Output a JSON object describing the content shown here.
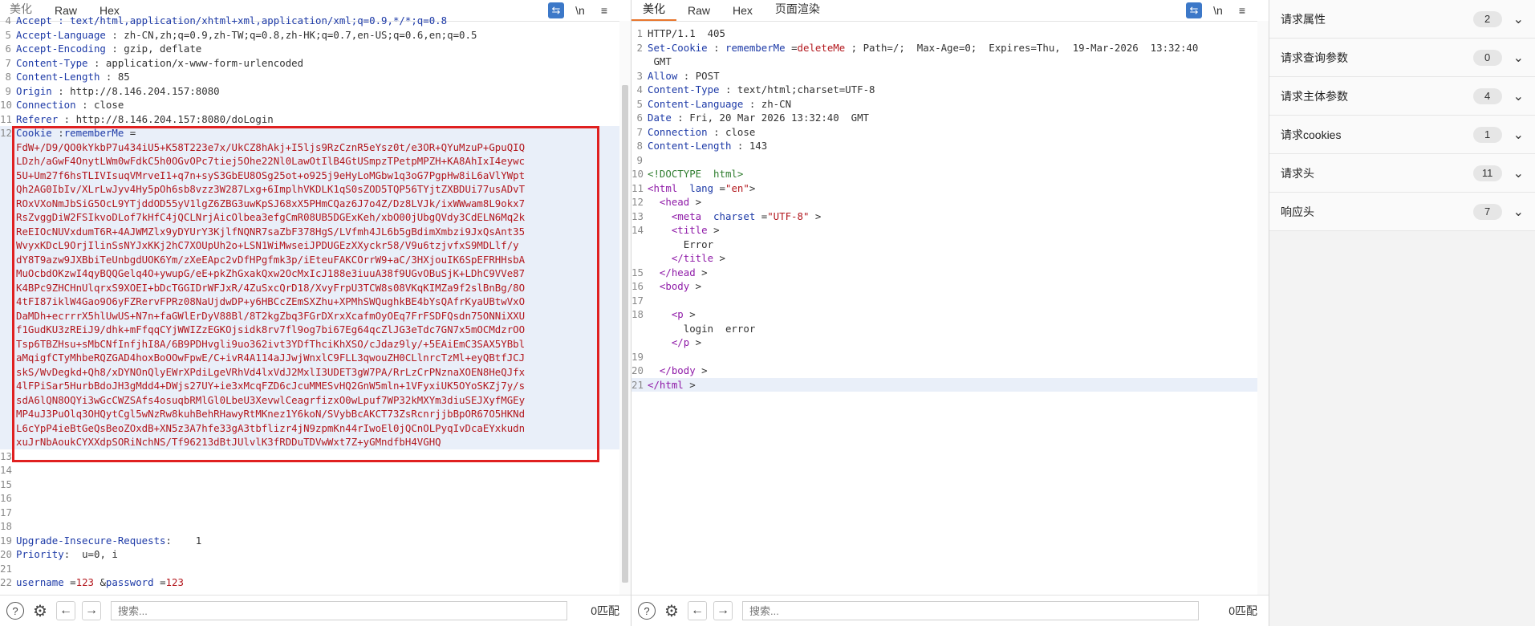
{
  "request": {
    "tabs": [
      "美化",
      "Raw",
      "Hex"
    ],
    "lines": [
      {
        "num": "4",
        "parts": [
          {
            "t": "Accept : text/html,application/xhtml+xml,application/xml;q=0.9,*/*;q=0.8",
            "c": "k"
          }
        ]
      },
      {
        "num": "5",
        "parts": [
          {
            "t": "Accept-Language",
            "c": "k"
          },
          {
            "t": " : zh-CN,zh;q=0.9,zh-TW;q=0.8,zh-HK;q=0.7,en-US;q=0.6,en;q=0.5",
            "c": "v"
          }
        ]
      },
      {
        "num": "6",
        "parts": [
          {
            "t": "Accept-Encoding",
            "c": "k"
          },
          {
            "t": " : gzip, deflate",
            "c": "v"
          }
        ]
      },
      {
        "num": "7",
        "parts": [
          {
            "t": "Content-Type",
            "c": "k"
          },
          {
            "t": " : application/x-www-form-urlencoded",
            "c": "v"
          }
        ]
      },
      {
        "num": "8",
        "parts": [
          {
            "t": "Content-Length",
            "c": "k"
          },
          {
            "t": " : 85",
            "c": "v"
          }
        ]
      },
      {
        "num": "9",
        "parts": [
          {
            "t": "Origin",
            "c": "k"
          },
          {
            "t": " : http://8.146.204.157:8080",
            "c": "v"
          }
        ]
      },
      {
        "num": "10",
        "parts": [
          {
            "t": "Connection",
            "c": "k"
          },
          {
            "t": " : close",
            "c": "v"
          }
        ]
      },
      {
        "num": "11",
        "parts": [
          {
            "t": "Referer",
            "c": "k"
          },
          {
            "t": " : http://8.146.204.157:8080/doLogin",
            "c": "v"
          }
        ]
      },
      {
        "num": "12",
        "hl": true,
        "parts": [
          {
            "t": "Cookie",
            "c": "k"
          },
          {
            "t": " :",
            "c": "v"
          },
          {
            "t": "rememberMe",
            "c": "k"
          },
          {
            "t": " =",
            "c": "v"
          }
        ]
      },
      {
        "num": "",
        "hl": true,
        "parts": [
          {
            "t": "FdW+/D9/QO0kYkbP7u434iU5+K58T223e7x/UkCZ8hAkj+I5ljs9RzCznR5eYsz0t/e3OR+QYuMzuP+GpuQIQ",
            "c": "red"
          }
        ]
      },
      {
        "num": "",
        "hl": true,
        "parts": [
          {
            "t": "LDzh/aGwF4OnytLWm0wFdkC5h0OGvOPc7tiej5Ohe22Nl0LawOtIlB4GtUSmpzTPetpMPZH+KA8AhIxI4eywc",
            "c": "red"
          }
        ]
      },
      {
        "num": "",
        "hl": true,
        "parts": [
          {
            "t": "5U+Um27f6hsTLIVIsuqVMrveI1+q7n+syS3GbEU8OSg25ot+o925j9eHyLoMGbw1q3oG7PgpHw8iL6aVlYWpt",
            "c": "red"
          }
        ]
      },
      {
        "num": "",
        "hl": true,
        "parts": [
          {
            "t": "Qh2AG0IbIv/XLrLwJyv4Hy5pOh6sb8vzz3W287Lxg+6ImplhVKDLK1qS0sZOD5TQP56TYjtZXBDUi77usADvT",
            "c": "red"
          }
        ]
      },
      {
        "num": "",
        "hl": true,
        "parts": [
          {
            "t": "ROxVXoNmJbSiG5OcL9YTjddOD55yV1lgZ6ZBG3uwKpSJ68xX5PHmCQaz6J7o4Z/Dz8LVJk/ixWWwam8L9okx7",
            "c": "red"
          }
        ]
      },
      {
        "num": "",
        "hl": true,
        "parts": [
          {
            "t": "RsZvggDiW2FSIkvoDLof7kHfC4jQCLNrjAicOlbea3efgCmR08UB5DGExKeh/xbO00jUbgQVdy3CdELN6Mq2k",
            "c": "red"
          }
        ]
      },
      {
        "num": "",
        "hl": true,
        "parts": [
          {
            "t": "ReEIOcNUVxdumT6R+4AJWMZlx9yDYUrY3KjlfNQNR7saZbF378HgS/LVfmh4JL6b5gBdimXmbzi9JxQsAnt35",
            "c": "red"
          }
        ]
      },
      {
        "num": "",
        "hl": true,
        "parts": [
          {
            "t": "WvyxKDcL9OrjIlinSsNYJxKKj2hC7XOUpUh2o+LSN1WiMwseiJPDUGEzXXyckr58/V9u6tzjvfxS9MDLlf/y",
            "c": "red"
          }
        ]
      },
      {
        "num": "",
        "hl": true,
        "parts": [
          {
            "t": "dY8T9azw9JXBbiTeUnbgdUOK6Ym/zXeEApc2vDfHPgfmk3p/iEteuFAKCOrrW9+aC/3HXjouIK6SpEFRHHsbA",
            "c": "red"
          }
        ]
      },
      {
        "num": "",
        "hl": true,
        "parts": [
          {
            "t": "MuOcbdOKzwI4qyBQQGelq4O+ywupG/eE+pkZhGxakQxw2OcMxIcJ188e3iuuA38f9UGvOBuSjK+LDhC9VVe87",
            "c": "red"
          }
        ]
      },
      {
        "num": "",
        "hl": true,
        "parts": [
          {
            "t": "K4BPc9ZHCHnUlqrxS9XOEI+bDcTGGIDrWFJxR/4ZuSxcQrD18/XvyFrpU3TCW8s08VKqKIMZa9f2slBnBg/8O",
            "c": "red"
          }
        ]
      },
      {
        "num": "",
        "hl": true,
        "parts": [
          {
            "t": "4tFI87iklW4Gao9O6yFZRervFPRz08NaUjdwDP+y6HBCcZEmSXZhu+XPMhSWQughkBE4bYsQAfrKyaUBtwVxO",
            "c": "red"
          }
        ]
      },
      {
        "num": "",
        "hl": true,
        "parts": [
          {
            "t": "DaMDh+ecrrrX5hlUwUS+N7n+faGWlErDyV88Bl/8T2kgZbq3FGrDXrxXcafmOyOEq7FrFSDFQsdn75ONNiXXU",
            "c": "red"
          }
        ]
      },
      {
        "num": "",
        "hl": true,
        "parts": [
          {
            "t": "f1GudKU3zREiJ9/dhk+mFfqqCYjWWIZzEGKOjsidk8rv7fl9og7bi67Eg64qcZlJG3eTdc7GN7x5mOCMdzrOO",
            "c": "red"
          }
        ]
      },
      {
        "num": "",
        "hl": true,
        "parts": [
          {
            "t": "Tsp6TBZHsu+sMbCNfInfjhI8A/6B9PDHvgli9uo362ivt3YDfThciKhXSO/cJdaz9ly/+5EAiEmC3SAX5YBbl",
            "c": "red"
          }
        ]
      },
      {
        "num": "",
        "hl": true,
        "parts": [
          {
            "t": "aMqigfCTyMhbeRQZGAD4hoxBoOOwFpwE/C+ivR4A114aJJwjWnxlC9FLL3qwouZH0CLlnrcTzMl+eyQBtfJCJ",
            "c": "red"
          }
        ]
      },
      {
        "num": "",
        "hl": true,
        "parts": [
          {
            "t": "skS/WvDegkd+Qh8/xDYNOnQlyEWrXPdiLgeVRhVd4lxVdJ2MxlI3UDET3gW7PA/RrLzCrPNznaXOEN8HeQJfx",
            "c": "red"
          }
        ]
      },
      {
        "num": "",
        "hl": true,
        "parts": [
          {
            "t": "4lFPiSar5HurbBdoJH3gMdd4+DWjs27UY+ie3xMcqFZD6cJcuMMESvHQ2GnW5mln+1VFyxiUK5OYoSKZj7y/s",
            "c": "red"
          }
        ]
      },
      {
        "num": "",
        "hl": true,
        "parts": [
          {
            "t": "sdA6lQN8OQYi3wGcCWZSAfs4osuqbRMlGl0LbeU3XevwlCeagrfizxO0wLpuf7WP32kMXYm3diuSEJXyfMGEy",
            "c": "red"
          }
        ]
      },
      {
        "num": "",
        "hl": true,
        "parts": [
          {
            "t": "MP4uJ3PuOlq3OHQytCgl5wNzRw8kuhBehRHawyRtMKnez1Y6koN/SVybBcAKCT73ZsRcnrjjbBpOR67O5HKNd",
            "c": "red"
          }
        ]
      },
      {
        "num": "",
        "hl": true,
        "parts": [
          {
            "t": "L6cYpP4ieBtGeQsBeoZOxdB+XN5z3A7hfe33gA3tbflizr4jN9zpmKn44rIwoEl0jQCnOLPyqIvDcaEYxkudn",
            "c": "red"
          }
        ]
      },
      {
        "num": "",
        "hl": true,
        "parts": [
          {
            "t": "xuJrNbAoukCYXXdpSORiNchNS/Tf96213dBtJUlvlK3fRDDuTDVwWxt7Z+yGMndfbH4VGHQ",
            "c": "red"
          }
        ]
      },
      {
        "num": "13",
        "parts": []
      },
      {
        "num": "14",
        "parts": []
      },
      {
        "num": "15",
        "parts": []
      },
      {
        "num": "16",
        "parts": []
      },
      {
        "num": "17",
        "parts": []
      },
      {
        "num": "18",
        "parts": []
      },
      {
        "num": "19",
        "parts": [
          {
            "t": "Upgrade-Insecure-Requests",
            "c": "k"
          },
          {
            "t": ":    1",
            "c": "v"
          }
        ]
      },
      {
        "num": "20",
        "parts": [
          {
            "t": "Priority",
            "c": "k"
          },
          {
            "t": ":  u=0, i",
            "c": "v"
          }
        ]
      },
      {
        "num": "21",
        "parts": []
      },
      {
        "num": "22",
        "parts": [
          {
            "t": "username",
            "c": "k"
          },
          {
            "t": " =",
            "c": "v"
          },
          {
            "t": "123",
            "c": "red"
          },
          {
            "t": " &",
            "c": "v"
          },
          {
            "t": "password",
            "c": "k"
          },
          {
            "t": " =",
            "c": "v"
          },
          {
            "t": "123",
            "c": "red"
          }
        ]
      }
    ],
    "search_placeholder": "搜索...",
    "match_text": "0匹配"
  },
  "response": {
    "tabs": [
      "美化",
      "Raw",
      "Hex",
      "页面渲染"
    ],
    "lines": [
      {
        "num": "1",
        "parts": [
          {
            "t": "HTTP/1.1  405",
            "c": "v"
          }
        ]
      },
      {
        "num": "2",
        "parts": [
          {
            "t": "Set-Cookie",
            "c": "k"
          },
          {
            "t": " : ",
            "c": "v"
          },
          {
            "t": "rememberMe",
            "c": "k"
          },
          {
            "t": " =",
            "c": "v"
          },
          {
            "t": "deleteMe",
            "c": "red"
          },
          {
            "t": " ; Path=/;  Max-Age=0;  Expires=Thu,  19-Mar-2026  13:32:40",
            "c": "v"
          }
        ]
      },
      {
        "num": "",
        "parts": [
          {
            "t": " GMT",
            "c": "v"
          }
        ]
      },
      {
        "num": "3",
        "parts": [
          {
            "t": "Allow",
            "c": "k"
          },
          {
            "t": " : POST",
            "c": "v"
          }
        ]
      },
      {
        "num": "4",
        "parts": [
          {
            "t": "Content-Type",
            "c": "k"
          },
          {
            "t": " : text/html;charset=UTF-8",
            "c": "v"
          }
        ]
      },
      {
        "num": "5",
        "parts": [
          {
            "t": "Content-Language",
            "c": "k"
          },
          {
            "t": " : zh-CN",
            "c": "v"
          }
        ]
      },
      {
        "num": "6",
        "parts": [
          {
            "t": "Date",
            "c": "k"
          },
          {
            "t": " : Fri, 20 Mar 2026 13:32:40  GMT",
            "c": "v"
          }
        ]
      },
      {
        "num": "7",
        "parts": [
          {
            "t": "Connection",
            "c": "k"
          },
          {
            "t": " : close",
            "c": "v"
          }
        ]
      },
      {
        "num": "8",
        "parts": [
          {
            "t": "Content-Length",
            "c": "k"
          },
          {
            "t": " : 143",
            "c": "v"
          }
        ]
      },
      {
        "num": "9",
        "parts": []
      },
      {
        "num": "10",
        "parts": [
          {
            "t": "<!DOCTYPE  html>",
            "c": "green"
          }
        ]
      },
      {
        "num": "11",
        "parts": [
          {
            "t": "<html",
            "c": "purple"
          },
          {
            "t": "  lang",
            "c": "blue"
          },
          {
            "t": " =",
            "c": "v"
          },
          {
            "t": "\"en\"",
            "c": "red"
          },
          {
            "t": ">",
            "c": "v"
          }
        ]
      },
      {
        "num": "12",
        "parts": [
          {
            "t": "  <head",
            "c": "purple"
          },
          {
            "t": " >",
            "c": "v"
          }
        ]
      },
      {
        "num": "13",
        "parts": [
          {
            "t": "    <meta",
            "c": "purple"
          },
          {
            "t": "  charset",
            "c": "blue"
          },
          {
            "t": " =",
            "c": "v"
          },
          {
            "t": "\"UTF-8\"",
            "c": "red"
          },
          {
            "t": " >",
            "c": "v"
          }
        ]
      },
      {
        "num": "14",
        "parts": [
          {
            "t": "    <title",
            "c": "purple"
          },
          {
            "t": " >",
            "c": "v"
          }
        ]
      },
      {
        "num": "",
        "parts": [
          {
            "t": "      Error",
            "c": "v"
          }
        ]
      },
      {
        "num": "",
        "parts": [
          {
            "t": "    </title",
            "c": "purple"
          },
          {
            "t": " >",
            "c": "v"
          }
        ]
      },
      {
        "num": "15",
        "parts": [
          {
            "t": "  </head",
            "c": "purple"
          },
          {
            "t": " >",
            "c": "v"
          }
        ]
      },
      {
        "num": "16",
        "parts": [
          {
            "t": "  <body",
            "c": "purple"
          },
          {
            "t": " >",
            "c": "v"
          }
        ]
      },
      {
        "num": "17",
        "parts": []
      },
      {
        "num": "18",
        "parts": [
          {
            "t": "    <p",
            "c": "purple"
          },
          {
            "t": " >",
            "c": "v"
          }
        ]
      },
      {
        "num": "",
        "parts": [
          {
            "t": "      login  error",
            "c": "v"
          }
        ]
      },
      {
        "num": "",
        "parts": [
          {
            "t": "    </p",
            "c": "purple"
          },
          {
            "t": " >",
            "c": "v"
          }
        ]
      },
      {
        "num": "19",
        "parts": []
      },
      {
        "num": "20",
        "parts": [
          {
            "t": "  </body",
            "c": "purple"
          },
          {
            "t": " >",
            "c": "v"
          }
        ]
      },
      {
        "num": "21",
        "hl": true,
        "parts": [
          {
            "t": "</html",
            "c": "purple"
          },
          {
            "t": " >",
            "c": "v"
          }
        ]
      }
    ],
    "search_placeholder": "搜索...",
    "match_text": "0匹配"
  },
  "inspector": {
    "rows": [
      {
        "label": "请求属性",
        "count": "2"
      },
      {
        "label": "请求查询参数",
        "count": "0"
      },
      {
        "label": "请求主体参数",
        "count": "4"
      },
      {
        "label": "请求cookies",
        "count": "1"
      },
      {
        "label": "请求头",
        "count": "11"
      },
      {
        "label": "响应头",
        "count": "7"
      }
    ]
  },
  "icons": {
    "wrap": "wrap-icon",
    "newline": "\\n",
    "menu": "≡",
    "help": "?",
    "settings": "⚙",
    "prev": "←",
    "next": "→",
    "chevron": "⌄"
  },
  "colors": {
    "accent": "#e8762d",
    "highlight_box": "#e02020",
    "key": "#1d3aa7",
    "value_red": "#b3181e"
  }
}
